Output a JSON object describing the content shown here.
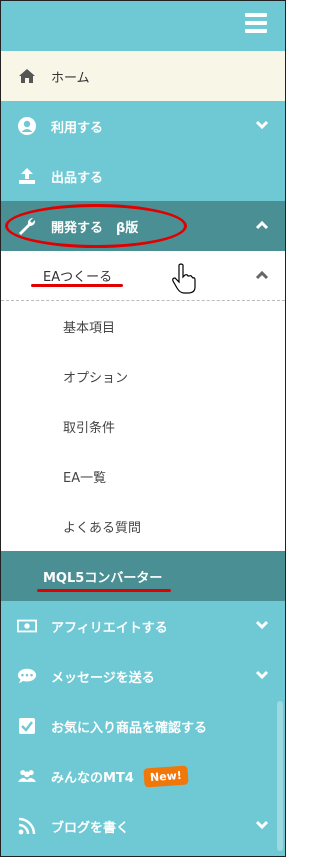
{
  "menu": {
    "home": "ホーム",
    "use": "利用する",
    "sell": "出品する",
    "develop": "開発する　β版",
    "ea_make": "EAつくーる",
    "sub": [
      "基本項目",
      "オプション",
      "取引条件",
      "EA一覧",
      "よくある質問"
    ],
    "mql5": "MQL5コンバーター",
    "affiliate": "アフィリエイトする",
    "message": "メッセージを送る",
    "favorites": "お気に入り商品を確認する",
    "mt4": "みんなのMT4",
    "new_badge": "New!",
    "blog": "ブログを書く"
  },
  "colors": {
    "teal": "#6fc9d4",
    "dark_teal": "#4a8f93",
    "highlight": "#e00000",
    "badge": "#f0780a"
  }
}
